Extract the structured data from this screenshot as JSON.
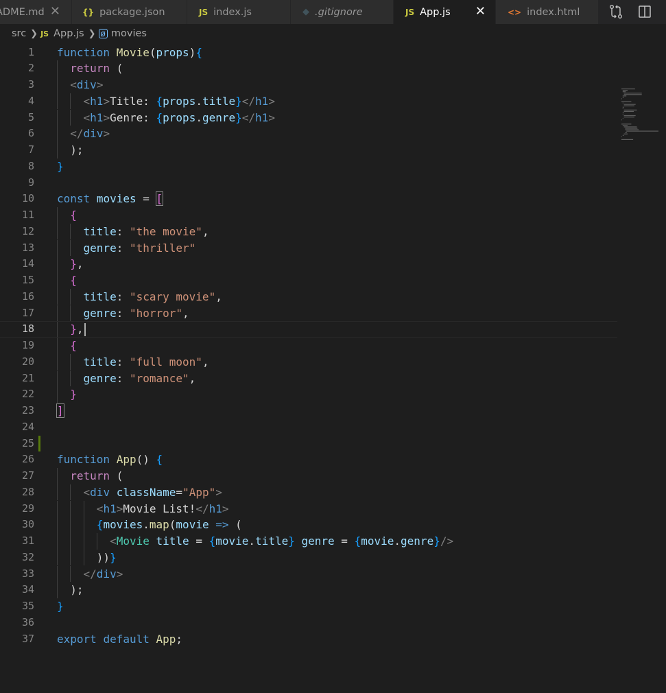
{
  "tabs": [
    {
      "label": "ADME.md",
      "icon": "markdown-icon",
      "has_close": true
    },
    {
      "label": "package.json",
      "icon": "json-icon",
      "icon_text": "{}"
    },
    {
      "label": "index.js",
      "icon": "js-icon",
      "icon_text": "JS"
    },
    {
      "label": ".gitignore",
      "icon": "git-icon",
      "icon_text": "◆"
    },
    {
      "label": "App.js",
      "icon": "js-icon",
      "icon_text": "JS",
      "active": true
    },
    {
      "label": "index.html",
      "icon": "html-icon",
      "icon_text": "<>"
    }
  ],
  "tab_close_glyph": "✕",
  "tab_actions": [
    "source-control-compare-icon",
    "split-editor-icon"
  ],
  "breadcrumb": {
    "folder": "src",
    "file_icon_text": "JS",
    "file": "App.js",
    "symbol_icon_text": "[ø]",
    "symbol": "movies"
  },
  "editor": {
    "active_line": 18,
    "line_numbers": [
      "1",
      "2",
      "3",
      "4",
      "5",
      "6",
      "7",
      "8",
      "9",
      "10",
      "11",
      "12",
      "13",
      "14",
      "15",
      "16",
      "17",
      "18",
      "19",
      "20",
      "21",
      "22",
      "23",
      "24",
      "25",
      "26",
      "27",
      "28",
      "29",
      "30",
      "31",
      "32",
      "33",
      "34",
      "35",
      "36",
      "37"
    ],
    "lines": [
      "function Movie(props){",
      "  return (",
      "  <div>",
      "    <h1>Title: {props.title}</h1>",
      "    <h1>Genre: {props.genre}</h1>",
      "  </div>",
      "  );",
      "}",
      "",
      "const movies = [",
      "  {",
      "    title: \"the movie\",",
      "    genre: \"thriller\"",
      "  },",
      "  {",
      "    title: \"scary movie\",",
      "    genre: \"horror\",",
      "  },",
      "  {",
      "    title: \"full moon\",",
      "    genre: \"romance\",",
      "  }",
      "]",
      "",
      "",
      "function App() {",
      "  return (",
      "    <div className=\"App\">",
      "      <h1>Movie List!</h1>",
      "      {movies.map(movie => (",
      "        <Movie title = {movie.title} genre = {movie.genre}/>",
      "      ))}",
      "    </div>",
      "  );",
      "}",
      "",
      "export default App;"
    ]
  },
  "colors": {
    "editor_bg": "#1e1e1e",
    "keyword": "#569cd6",
    "control": "#c586c0",
    "function": "#dcdcaa",
    "variable": "#9cdcfe",
    "string": "#ce9178",
    "component": "#4ec9b0",
    "git_added": "#587c0c"
  }
}
